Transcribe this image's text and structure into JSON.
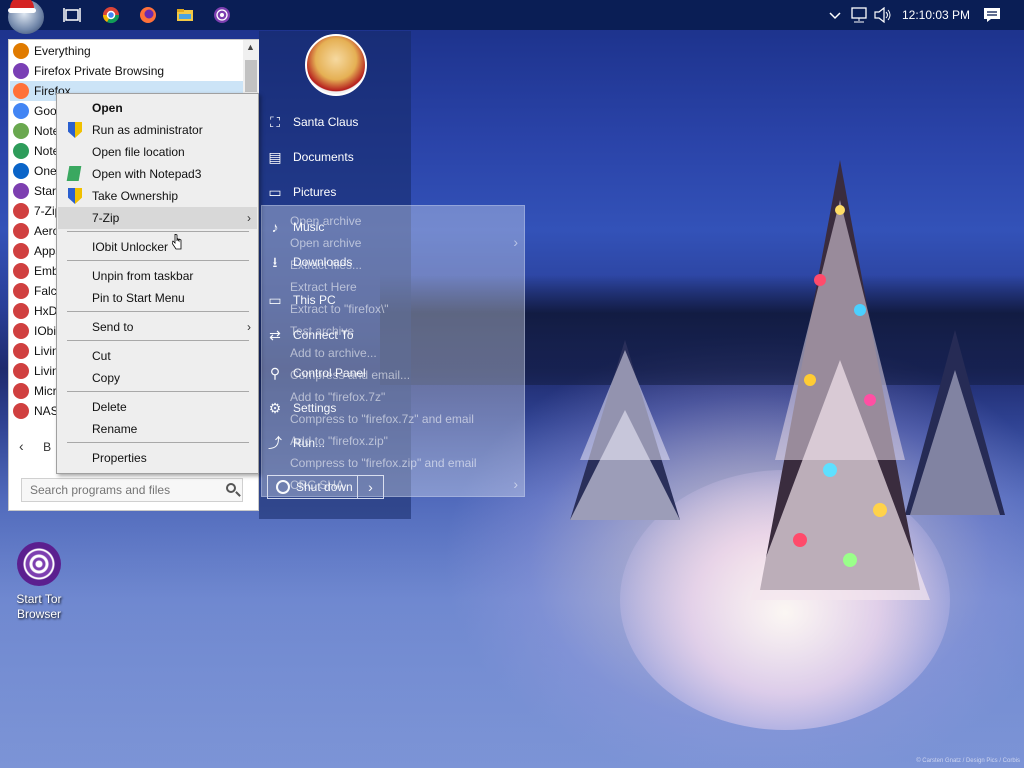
{
  "taskbar": {
    "clock": "12:10:03 PM",
    "pinned_icons": [
      "task-view-icon",
      "chrome-icon",
      "firefox-icon",
      "file-explorer-icon",
      "tor-browser-icon"
    ],
    "tray_icons": [
      "chevron-up-icon",
      "network-icon",
      "volume-icon",
      "notification-icon"
    ]
  },
  "start_menu": {
    "programs": [
      {
        "label": "Everything",
        "icon": "everything-icon",
        "color": "#e07b00"
      },
      {
        "label": "Firefox Private Browsing",
        "icon": "firefox-private-icon",
        "color": "#7a3fb5"
      },
      {
        "label": "Firefox",
        "icon": "firefox-icon",
        "color": "#ff7139",
        "selected": true
      },
      {
        "label": "Goo",
        "icon": "chrome-icon",
        "color": "#4285f4"
      },
      {
        "label": "Note",
        "icon": "notepad-icon",
        "color": "#6aa84f"
      },
      {
        "label": "Note",
        "icon": "notepad3-icon",
        "color": "#2e9c5a"
      },
      {
        "label": "OneI",
        "icon": "onedrive-icon",
        "color": "#0a64c8"
      },
      {
        "label": "Start",
        "icon": "tor-icon",
        "color": "#7d3fb0"
      },
      {
        "label": "7-Zip",
        "icon": "app-icon",
        "color": "#d04040"
      },
      {
        "label": "Aero",
        "icon": "app-icon",
        "color": "#d04040"
      },
      {
        "label": "Apps",
        "icon": "app-icon",
        "color": "#d04040"
      },
      {
        "label": "Emb",
        "icon": "app-icon",
        "color": "#d04040"
      },
      {
        "label": "Falco",
        "icon": "app-icon",
        "color": "#d04040"
      },
      {
        "label": "HxD",
        "icon": "app-icon",
        "color": "#d04040"
      },
      {
        "label": "IObit",
        "icon": "app-icon",
        "color": "#d04040"
      },
      {
        "label": "Livin",
        "icon": "app-icon",
        "color": "#d04040"
      },
      {
        "label": "Livin",
        "icon": "app-icon",
        "color": "#d04040"
      },
      {
        "label": "Micr",
        "icon": "app-icon",
        "color": "#d04040"
      },
      {
        "label": "NAS",
        "icon": "app-icon",
        "color": "#d04040"
      }
    ],
    "back_label": "B",
    "search_placeholder": "Search programs and files",
    "right_links": [
      {
        "label": "Santa Claus",
        "icon": "user-icon",
        "glyph": "⛶"
      },
      {
        "label": "Documents",
        "icon": "documents-icon",
        "glyph": "▤"
      },
      {
        "label": "Pictures",
        "icon": "pictures-icon",
        "glyph": "▭"
      },
      {
        "label": "Music",
        "icon": "music-icon",
        "glyph": "♪"
      },
      {
        "label": "Downloads",
        "icon": "downloads-icon",
        "glyph": "⭳"
      },
      {
        "label": "This PC",
        "icon": "computer-icon",
        "glyph": "▭"
      },
      {
        "label": "Connect To",
        "icon": "connect-icon",
        "glyph": "⇄"
      },
      {
        "label": "Control Panel",
        "icon": "wrench-icon",
        "glyph": "⚲"
      },
      {
        "label": "Settings",
        "icon": "gear-icon",
        "glyph": "⚙"
      },
      {
        "label": "Run...",
        "icon": "run-icon",
        "glyph": "⤴"
      }
    ],
    "shutdown_label": "Shut down",
    "shutdown_arrow": "›"
  },
  "ghost_submenu": [
    "Open archive",
    "Open archive",
    "Extract files...",
    "Extract Here",
    "Extract to \"firefox\\\"",
    "Test archive",
    "Add to archive...",
    "Compress and email...",
    "Add to \"firefox.7z\"",
    "Compress to \"firefox.7z\" and email",
    "Add to \"firefox.zip\"",
    "Compress to \"firefox.zip\" and email",
    "CRC SHA"
  ],
  "context_menu": {
    "items": [
      {
        "label": "Open",
        "bold": true
      },
      {
        "label": "Run as administrator",
        "icon": "shield"
      },
      {
        "label": "Open file location"
      },
      {
        "label": "Open with Notepad3",
        "icon": "notepad3"
      },
      {
        "label": "Take Ownership",
        "icon": "shield"
      },
      {
        "label": "7-Zip",
        "submenu": true,
        "hover": true
      },
      {
        "label": "IObit Unlocker"
      },
      {
        "label": "Unpin from taskbar"
      },
      {
        "label": "Pin to Start Menu"
      },
      {
        "label": "Send to",
        "submenu": true
      },
      {
        "label": "Cut"
      },
      {
        "label": "Copy"
      },
      {
        "label": "Delete"
      },
      {
        "label": "Rename"
      },
      {
        "label": "Properties"
      }
    ],
    "submenu_arrow": "›"
  },
  "desktop": {
    "icon_label_line1": "Start Tor",
    "icon_label_line2": "Browser",
    "wallpaper_credit": "© Carsten Gnatz / Design Pics / Corbis"
  }
}
